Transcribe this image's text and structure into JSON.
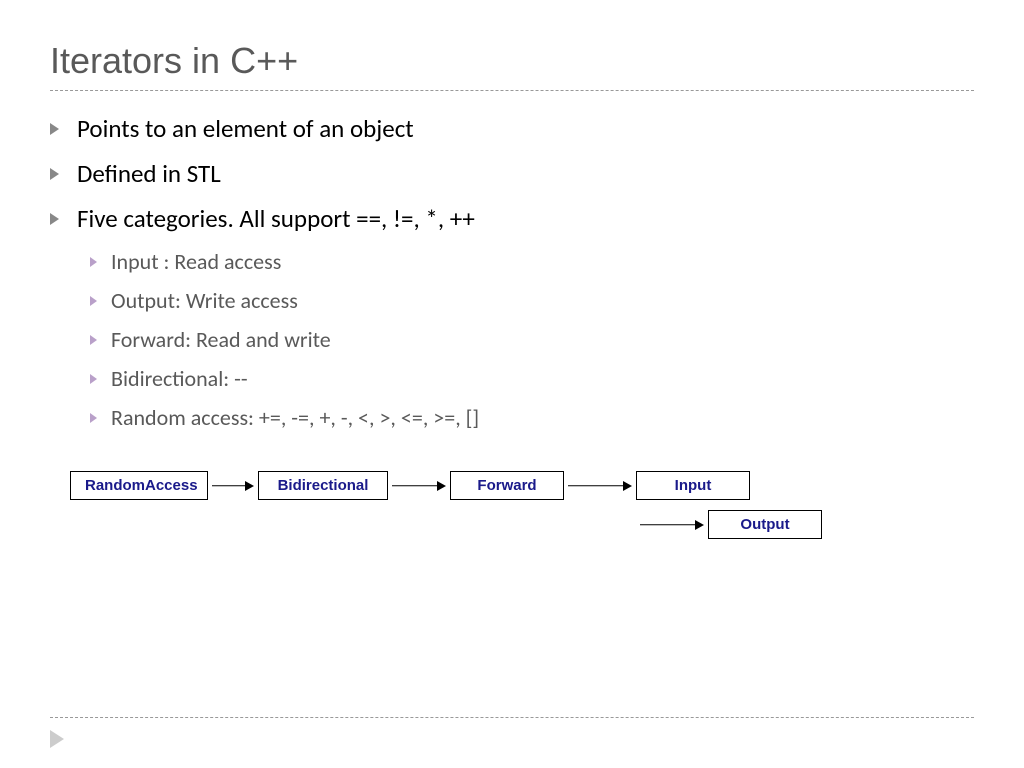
{
  "title": "Iterators in C++",
  "bullets": {
    "main": [
      "Points to an element of an object",
      "Defined in STL",
      "Five categories. All support ==, !=, *, ++"
    ],
    "sub": [
      "Input : Read access",
      "Output: Write access",
      "Forward: Read and write",
      "Bidirectional: --",
      "Random access: +=, -=, +, -, <, >, <=, >=, []"
    ]
  },
  "diagram": {
    "boxes": [
      "RandomAccess",
      "Bidirectional",
      "Forward",
      "Input",
      "Output"
    ]
  }
}
